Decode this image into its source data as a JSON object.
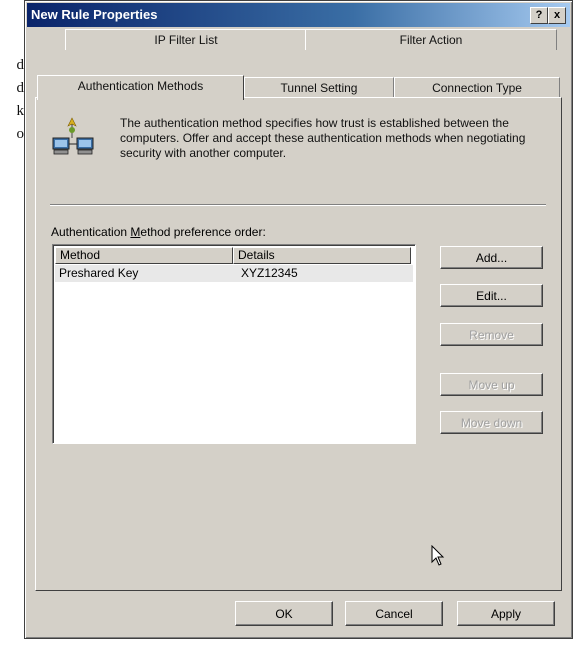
{
  "background_text": [
    "d",
    "d",
    "k",
    "o"
  ],
  "window": {
    "title": "New Rule Properties",
    "help_label": "?",
    "close_label": "x"
  },
  "tabs": {
    "back_row": [
      {
        "label": "IP Filter List"
      },
      {
        "label": "Filter Action"
      }
    ],
    "front_row": [
      {
        "label": "Authentication Methods",
        "active": true
      },
      {
        "label": "Tunnel Setting"
      },
      {
        "label": "Connection Type"
      }
    ]
  },
  "panel": {
    "icon": "network-computers-icon",
    "description": "The authentication method specifies how trust is established between the computers. Offer and accept these authentication methods when negotiating security with another computer.",
    "list_label_prefix": "Authentication ",
    "list_label_accel": "M",
    "list_label_suffix": "ethod preference order:",
    "list": {
      "columns": [
        "Method",
        "Details"
      ],
      "rows": [
        {
          "method": "Preshared Key",
          "details": "XYZ12345"
        }
      ]
    },
    "buttons": {
      "add": "Add...",
      "edit": "Edit...",
      "remove": "Remove",
      "move_up": "Move up",
      "move_down": "Move down"
    }
  },
  "footer": {
    "ok": "OK",
    "cancel": "Cancel",
    "apply": "Apply"
  },
  "colors": {
    "dialog_face": "#d4d0c8",
    "titlebar_start": "#0a246a",
    "titlebar_end": "#a6caf0",
    "disabled_text": "#a0a0a0"
  }
}
